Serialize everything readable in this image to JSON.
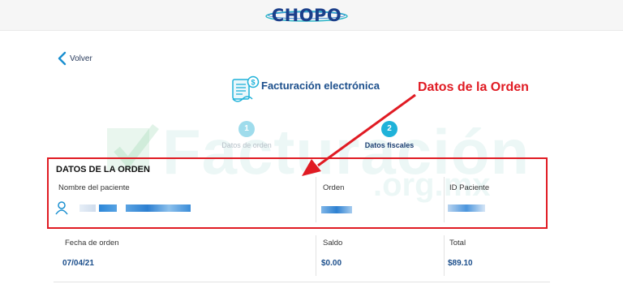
{
  "brand": {
    "logo_text": "CHOPO"
  },
  "nav": {
    "back_label": "Volver"
  },
  "header": {
    "title": "Facturación electrónica"
  },
  "watermark": {
    "main": "Facturación",
    "sub": ".org.mx"
  },
  "steps": [
    {
      "number": "1",
      "label": "Datos de orden"
    },
    {
      "number": "2",
      "label": "Datos fiscales"
    }
  ],
  "annotation": {
    "label": "Datos de la Orden"
  },
  "order": {
    "section_title": "DATOS DE LA ORDEN",
    "patient_name_label": "Nombre del paciente",
    "order_label": "Orden",
    "patient_id_label": "ID Paciente"
  },
  "summary": {
    "date_label": "Fecha de orden",
    "date_value": "07/04/21",
    "balance_label": "Saldo",
    "balance_value": "$0.00",
    "total_label": "Total",
    "total_value": "$89.10"
  },
  "colors": {
    "accent": "#1fb2d9",
    "brand_blue": "#1c4f8c",
    "annotation_red": "#e01b23"
  }
}
